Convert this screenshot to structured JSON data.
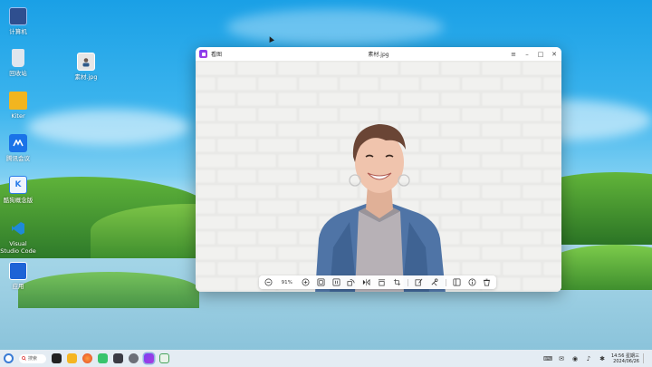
{
  "desktop": {
    "icons": [
      {
        "label": "计算机",
        "icon": "computer-icon"
      },
      {
        "label": "回收站",
        "icon": "trash-icon"
      },
      {
        "label": "素材.jpg",
        "icon": "image-file-icon"
      },
      {
        "label": "Kiter",
        "icon": "folder-icon"
      },
      {
        "label": "腾讯会议",
        "icon": "tencent-meeting-icon"
      },
      {
        "label": "酷狗概念版",
        "icon": "kugou-icon"
      },
      {
        "label": "Visual Studio Code",
        "icon": "vscode-icon"
      },
      {
        "label": "应用",
        "icon": "app-store-icon"
      }
    ]
  },
  "window": {
    "app_name": "看图",
    "file_title": "素材.jpg",
    "controls": {
      "menu": "≡",
      "minimize": "–",
      "maximize": "□",
      "close": "✕"
    },
    "toolbar": {
      "zoom": "91%"
    }
  },
  "taskbar": {
    "search_label": "搜索",
    "clock": {
      "time_weekday": "14:56 星期三",
      "date": "2024/06/26"
    }
  },
  "colors": {
    "accent": "#3a7bd5",
    "viewer_logo": "#8a3ef0",
    "window_bg": "#ffffff"
  }
}
